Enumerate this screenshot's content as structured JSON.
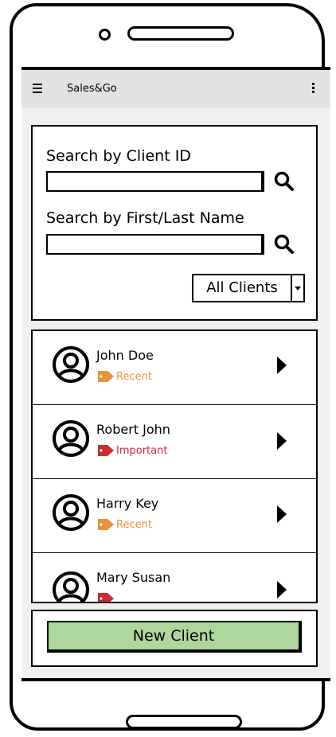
{
  "app": {
    "title": "Sales&Go"
  },
  "search": {
    "client_id_label": "Search by Client ID",
    "client_id_value": "",
    "name_label": "Search by First/Last Name",
    "name_value": "",
    "filter_selected": "All Clients"
  },
  "clients": [
    {
      "name": "John Doe",
      "tag": "Recent",
      "tag_color": "#e8923a"
    },
    {
      "name": "Robert John",
      "tag": "Important",
      "tag_color": "#d02a33"
    },
    {
      "name": "Harry Key",
      "tag": "Recent",
      "tag_color": "#e8923a"
    },
    {
      "name": "Mary Susan",
      "tag": "",
      "tag_color": "#d02a33"
    }
  ],
  "footer": {
    "new_client_label": "New Client"
  },
  "colors": {
    "app_bar": "#e2e2e2",
    "screen_bg": "#f0f0f0",
    "primary_button": "#add79d",
    "recent_tag": "#e8923a",
    "important_tag": "#d02a33"
  },
  "icons": {
    "menu": "hamburger-icon",
    "overflow": "kebab-menu-icon",
    "search": "magnifier-icon",
    "avatar": "user-avatar-icon",
    "tag": "tag-icon",
    "arrow": "play-arrow-icon"
  }
}
